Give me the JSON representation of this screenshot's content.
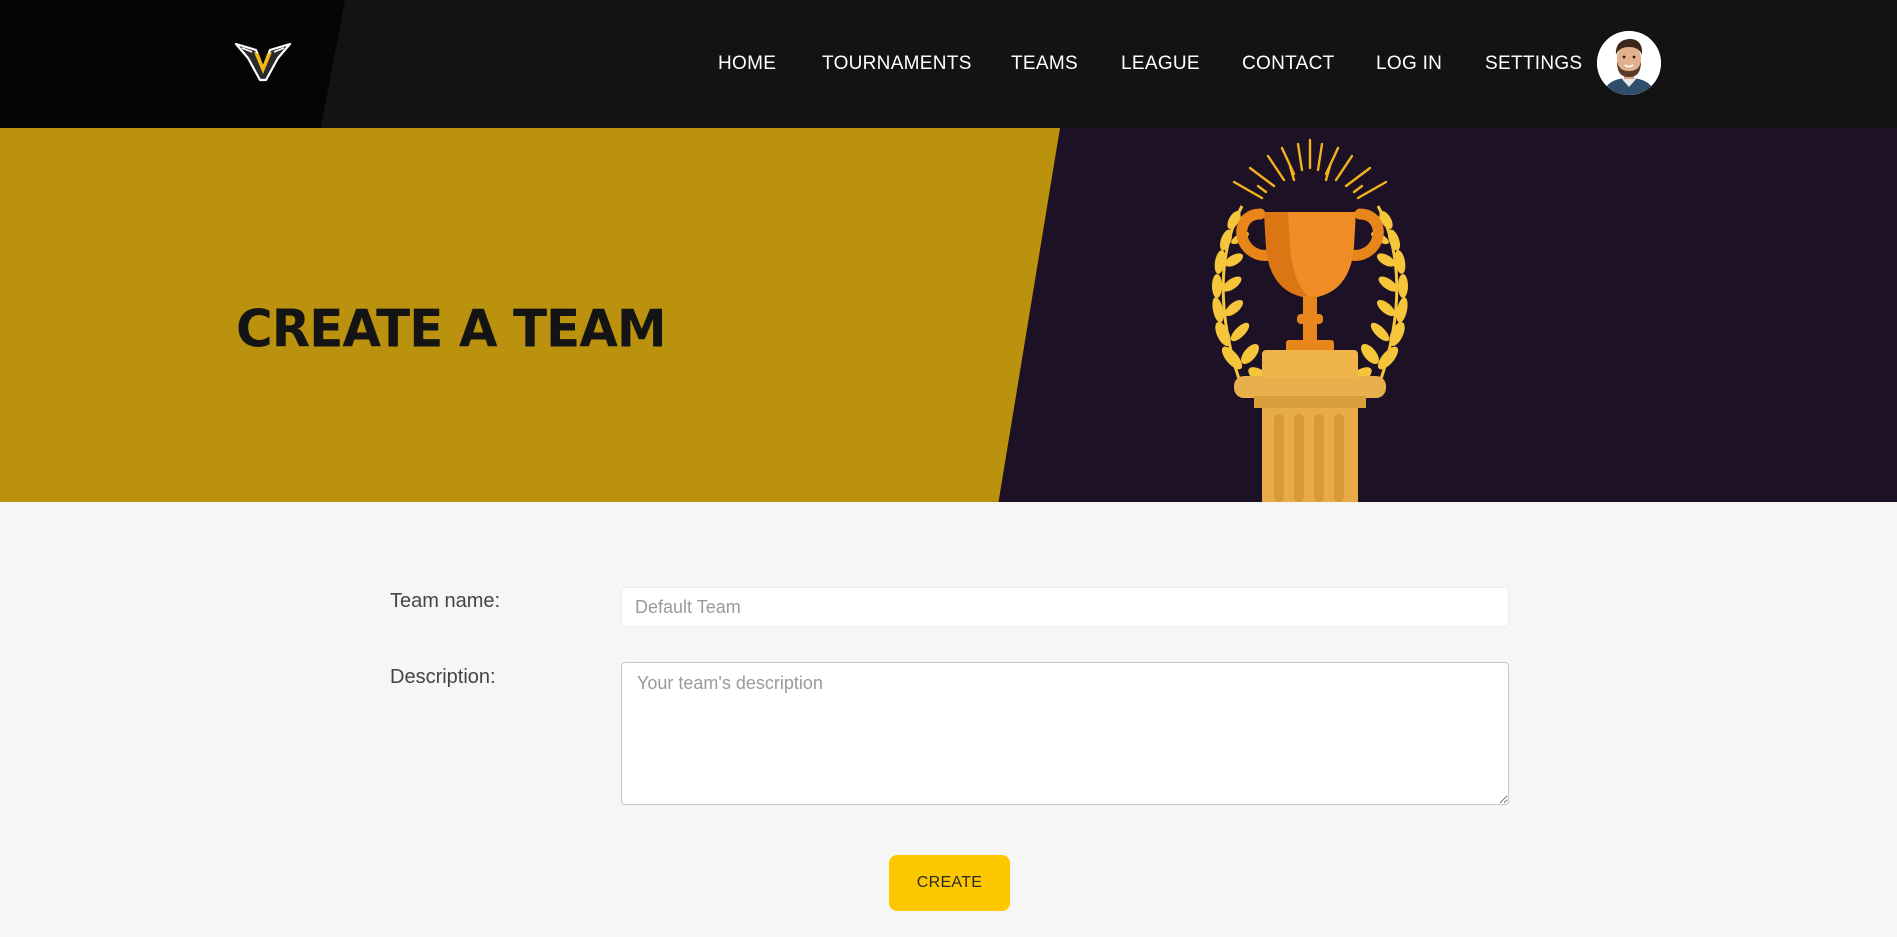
{
  "nav": {
    "items": [
      {
        "label": "HOME"
      },
      {
        "label": "TOURNAMENTS"
      },
      {
        "label": "TEAMS"
      },
      {
        "label": "LEAGUE"
      },
      {
        "label": "CONTACT"
      },
      {
        "label": "LOG IN"
      },
      {
        "label": "SETTINGS"
      }
    ],
    "logo_icon": "v-wings-logo-icon",
    "avatar_icon": "user-avatar"
  },
  "hero": {
    "title": "CREATE A TEAM",
    "illustration": "trophy-on-pedestal-with-laurel"
  },
  "form": {
    "team_name_label": "Team name:",
    "team_name_placeholder": "Default Team",
    "description_label": "Description:",
    "description_placeholder": "Your team's description",
    "submit_label": "CREATE"
  },
  "colors": {
    "header_bg": "#131313",
    "hero_left": "#bb920d",
    "hero_right": "#1d1126",
    "button": "#fdc700",
    "page_bg": "#f6f6f6"
  }
}
